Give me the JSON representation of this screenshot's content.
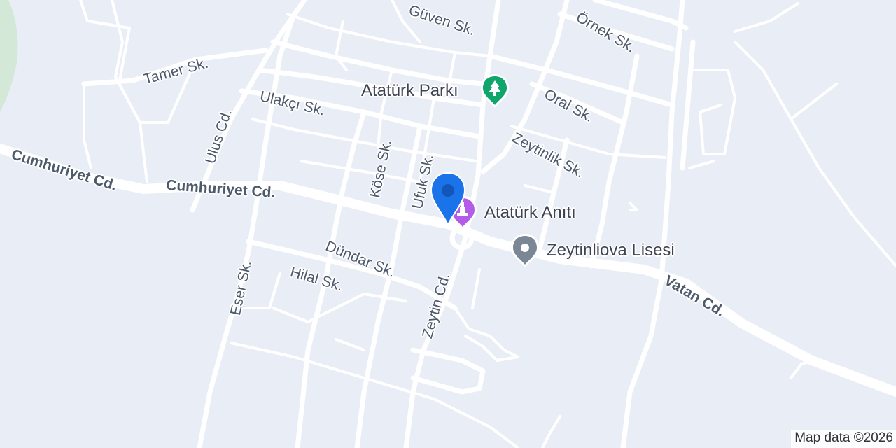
{
  "map": {
    "streets": [
      "Güven Sk.",
      "Örnek Sk.",
      "Tamer Sk.",
      "Ulakçı Sk.",
      "Ulus Cd.",
      "Oral Sk.",
      "Cumhuriyet Cd.",
      "Cumhuriyet Cd.",
      "Köse Sk.",
      "Ufuk Sk.",
      "Zeytinlik Sk.",
      "Dündar Sk.",
      "Hilal Sk.",
      "Eser Sk.",
      "Zeytin Cd.",
      "Vatan Cd."
    ],
    "pois": [
      {
        "name": "Atatürk Parkı",
        "icon": "park-tree-icon",
        "color": "#10a56a"
      },
      {
        "name": "Atatürk Anıtı",
        "icon": "monument-icon",
        "color": "#b35ce8"
      },
      {
        "name": "Zeytinliova Lisesi",
        "icon": "school-pin-icon",
        "color": "#7b8794"
      }
    ],
    "location_marker": {
      "icon": "location-pin-icon",
      "color": "#1a73e8"
    },
    "attribution": "Map data ©2026"
  }
}
